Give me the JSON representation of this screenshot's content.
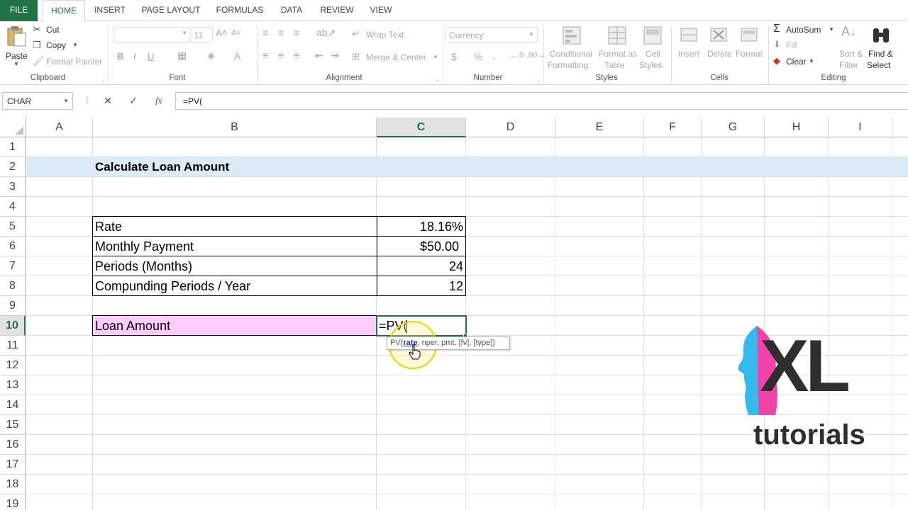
{
  "ribbon_tabs": [
    "FILE",
    "HOME",
    "INSERT",
    "PAGE LAYOUT",
    "FORMULAS",
    "DATA",
    "REVIEW",
    "VIEW"
  ],
  "clipboard": {
    "paste": "Paste",
    "cut": "Cut",
    "copy": "Copy",
    "format_painter": "Format Painter",
    "label": "Clipboard"
  },
  "font": {
    "size": "11",
    "bold": "B",
    "italic": "I",
    "underline": "U",
    "label": "Font"
  },
  "alignment": {
    "wrap_text": "Wrap Text",
    "merge_center": "Merge & Center",
    "label": "Alignment"
  },
  "number": {
    "format": "Currency",
    "currency_symbol": "$",
    "percent": "%",
    "comma": ",",
    "label": "Number"
  },
  "styles": {
    "conditional": "Conditional",
    "formatting": "Formatting",
    "format_as": "Format as",
    "table": "Table",
    "cell": "Cell",
    "styles": "Styles",
    "label": "Styles"
  },
  "cells": {
    "insert": "Insert",
    "delete": "Delete",
    "format": "Format",
    "label": "Cells"
  },
  "editing": {
    "autosum": "AutoSum",
    "fill": "Fill",
    "clear": "Clear",
    "sort": "Sort &",
    "filter": "Filter",
    "find": "Find &",
    "select": "Select",
    "label": "Editing"
  },
  "formula_bar": {
    "name_box": "CHAR",
    "formula": "=PV(",
    "cancel": "✕",
    "enter": "✓",
    "fx": "fx"
  },
  "columns": [
    "A",
    "B",
    "C",
    "D",
    "E",
    "F",
    "G",
    "H",
    "I"
  ],
  "rows": [
    "1",
    "2",
    "3",
    "4",
    "5",
    "6",
    "7",
    "8",
    "9",
    "10",
    "11",
    "12",
    "13",
    "14",
    "15",
    "16",
    "17",
    "18",
    "19"
  ],
  "sheet": {
    "title": "Calculate Loan Amount",
    "table": [
      {
        "label": "Rate",
        "value": "18.16%"
      },
      {
        "label": "Monthly Payment",
        "value": "$50.00"
      },
      {
        "label": "Periods (Months)",
        "value": "24"
      },
      {
        "label": "Compunding Periods / Year",
        "value": "12"
      }
    ],
    "result_label": "Loan Amount",
    "result_entry": "=PV("
  },
  "tooltip": {
    "fn": "PV(",
    "current_arg": "rate",
    "rest": ", nper, pmt, [fv], [type])"
  },
  "logo": {
    "big": "XL",
    "small": "tutorials"
  },
  "colors": {
    "accent": "#217346",
    "title_band": "#ddebf7",
    "result_fill": "#ffccff",
    "logo_pink": "#ee44aa",
    "logo_blue": "#33bbee",
    "logo_text": "#2e2e2e"
  }
}
